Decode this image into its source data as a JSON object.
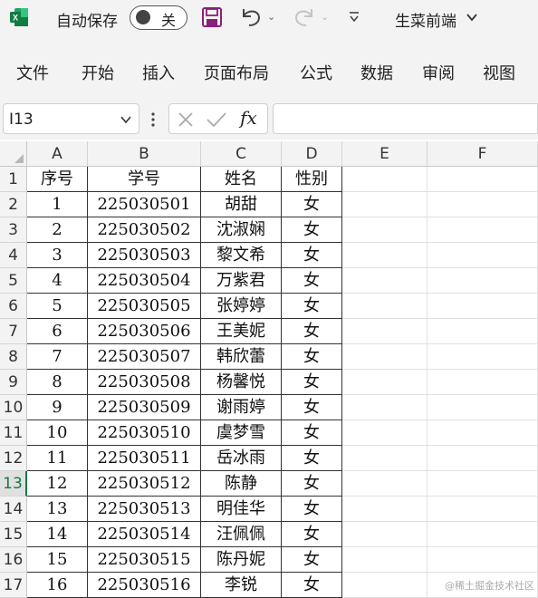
{
  "titlebar": {
    "autosave_label": "自动保存",
    "autosave_state": "关",
    "file_title": "生菜前端",
    "icons": [
      "excel-logo-icon",
      "save-icon",
      "undo-icon",
      "redo-icon",
      "customize-icon",
      "chevron-down-icon"
    ]
  },
  "ribbon": {
    "tabs": [
      "文件",
      "开始",
      "插入",
      "页面布局",
      "公式",
      "数据",
      "审阅",
      "视图"
    ]
  },
  "formula_bar": {
    "name_box": "I13",
    "fx": "fx",
    "formula": ""
  },
  "grid": {
    "columns": [
      "A",
      "B",
      "C",
      "D",
      "E",
      "F"
    ],
    "header_row": [
      "序号",
      "学号",
      "姓名",
      "性别"
    ],
    "rows": [
      [
        "1",
        "225030501",
        "胡甜",
        "女"
      ],
      [
        "2",
        "225030502",
        "沈淑娴",
        "女"
      ],
      [
        "3",
        "225030503",
        "黎文希",
        "女"
      ],
      [
        "4",
        "225030504",
        "万紫君",
        "女"
      ],
      [
        "5",
        "225030505",
        "张婷婷",
        "女"
      ],
      [
        "6",
        "225030506",
        "王美妮",
        "女"
      ],
      [
        "7",
        "225030507",
        "韩欣蕾",
        "女"
      ],
      [
        "8",
        "225030508",
        "杨馨悦",
        "女"
      ],
      [
        "9",
        "225030509",
        "谢雨婷",
        "女"
      ],
      [
        "10",
        "225030510",
        "虞梦雪",
        "女"
      ],
      [
        "11",
        "225030511",
        "岳冰雨",
        "女"
      ],
      [
        "12",
        "225030512",
        "陈静",
        "女"
      ],
      [
        "13",
        "225030513",
        "明佳华",
        "女"
      ],
      [
        "14",
        "225030514",
        "汪佩佩",
        "女"
      ],
      [
        "15",
        "225030515",
        "陈丹妮",
        "女"
      ],
      [
        "16",
        "225030516",
        "李锐",
        "女"
      ]
    ],
    "row_numbers": [
      "1",
      "2",
      "3",
      "4",
      "5",
      "6",
      "7",
      "8",
      "9",
      "10",
      "11",
      "12",
      "13",
      "14",
      "15",
      "16",
      "17"
    ],
    "active_row": 13,
    "accent_color": "#107c41"
  },
  "watermark": "@稀土掘金技术社区"
}
